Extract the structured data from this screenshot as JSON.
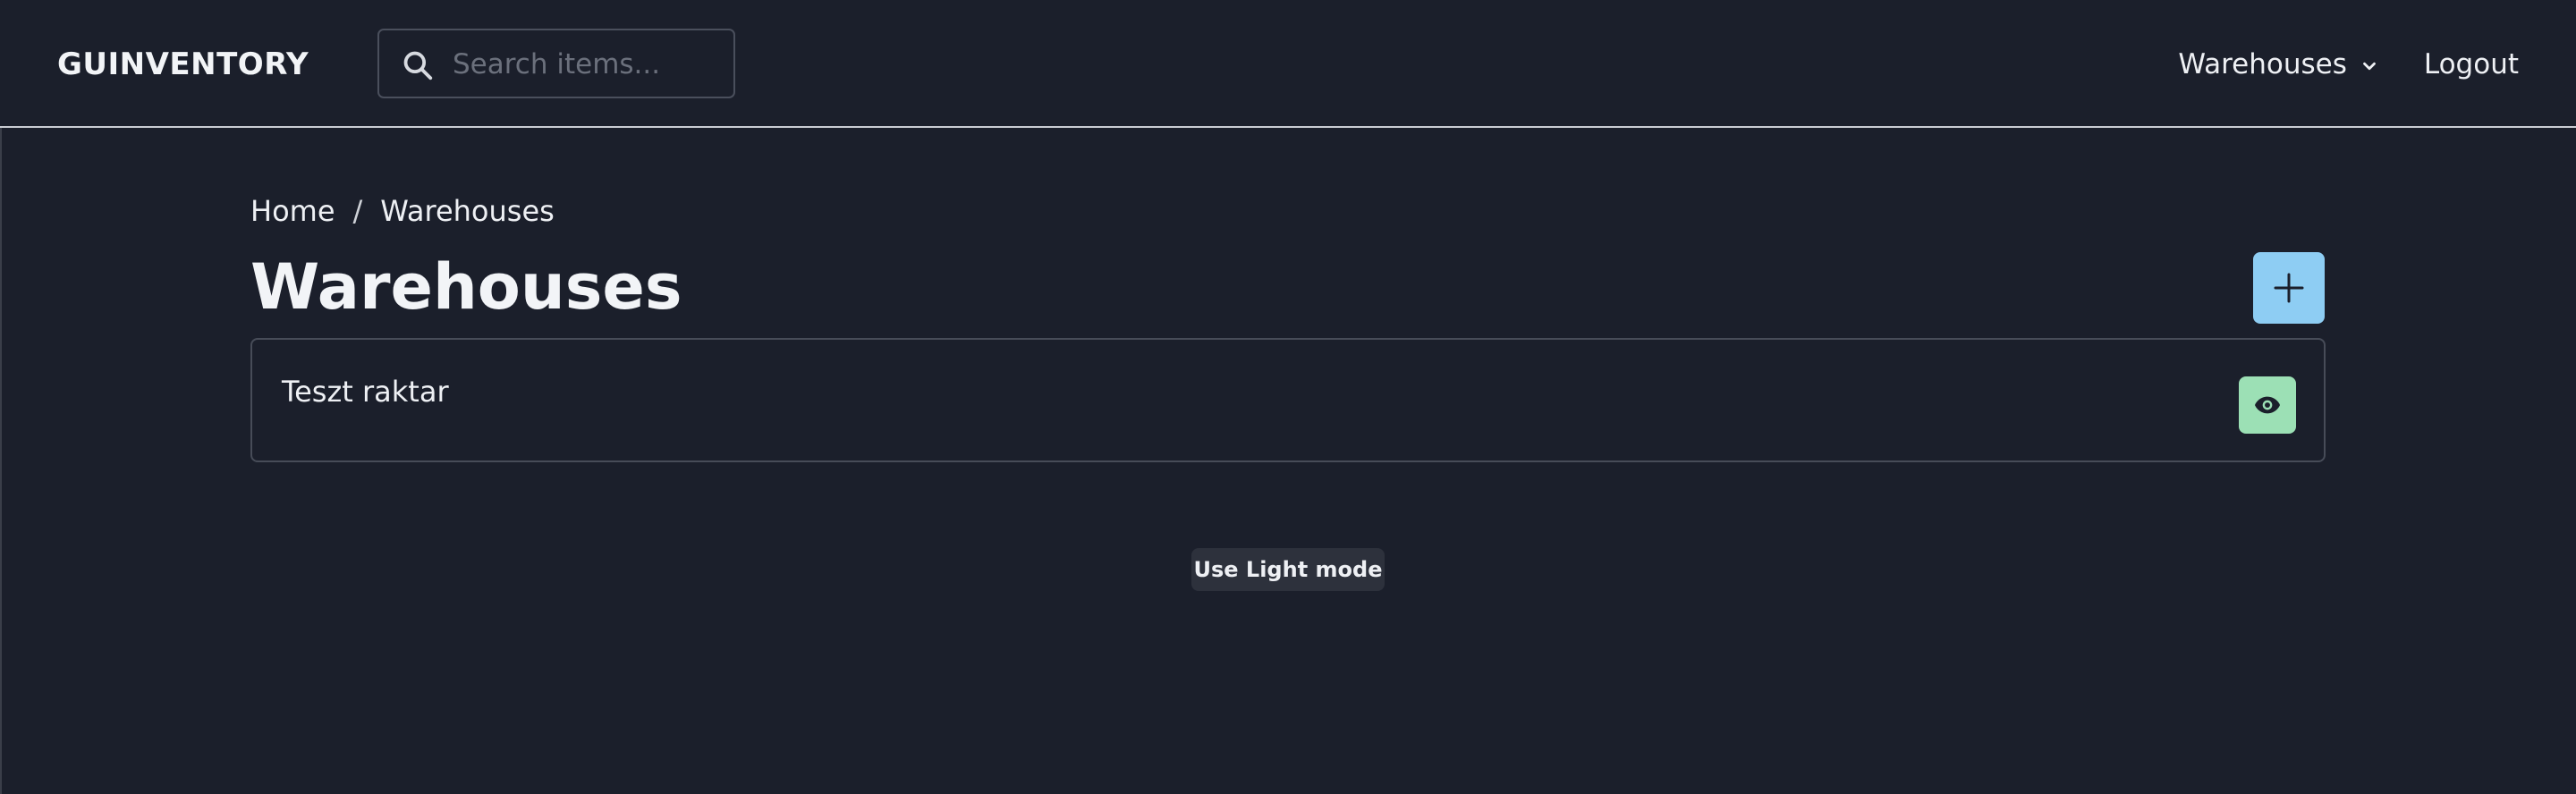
{
  "navbar": {
    "brand": "GUINVENTORY",
    "search": {
      "placeholder": "Search items...",
      "value": "",
      "icon": "search-icon"
    },
    "links": [
      {
        "label": "Warehouses",
        "icon": "chevron-down-icon"
      },
      {
        "label": "Logout"
      }
    ]
  },
  "breadcrumb": {
    "items": [
      "Home",
      "Warehouses"
    ],
    "separator": "/"
  },
  "main": {
    "title": "Warehouses",
    "add_button": {
      "icon": "plus-icon",
      "color": "#8ecdf3"
    },
    "warehouses": [
      {
        "name": "Teszt raktar",
        "action_icon": "eye-icon",
        "action_color": "#9ce0b5"
      }
    ]
  },
  "theme_toggle": {
    "label": "Use Light mode"
  },
  "colors": {
    "background": "#1b1f2b",
    "accent_blue": "#8ecdf3",
    "accent_green": "#9ce0b5",
    "text": "#eef0f4"
  }
}
